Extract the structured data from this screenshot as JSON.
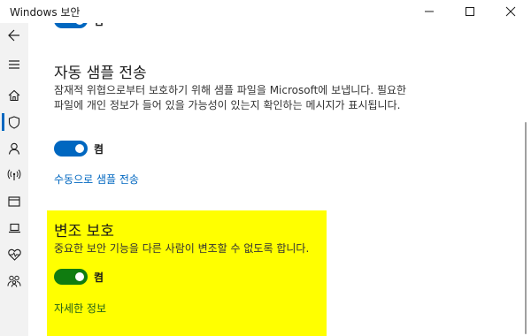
{
  "window": {
    "title": "Windows 보안"
  },
  "nav": {
    "icons": [
      "back-arrow-icon",
      "hamburger-menu-icon",
      "home-icon",
      "shield-icon",
      "person-icon",
      "wifi-antenna-icon",
      "app-browser-icon",
      "laptop-icon",
      "heart-icon",
      "family-icon"
    ]
  },
  "content": {
    "top_toggle_label": "켬",
    "auto_sample": {
      "title": "자동 샘플 전송",
      "description": "잠재적 위협으로부터 보호하기 위해 샘플 파일을 Microsoft에 보냅니다. 필요한 파일에 개인 정보가 들어 있을 가능성이 있는지 확인하는 메시지가 표시됩니다.",
      "toggle_label": "켬",
      "link": "수동으로 샘플 전송"
    },
    "tamper_protection": {
      "title": "변조 보호",
      "description": "중요한 보안 기능을 다른 사람이 변조할 수 없도록 합니다.",
      "toggle_label": "켬",
      "link": "자세한 정보"
    }
  },
  "colors": {
    "accent": "#0067c0",
    "highlight": "#ffff00",
    "toggle_green": "#107c10"
  }
}
